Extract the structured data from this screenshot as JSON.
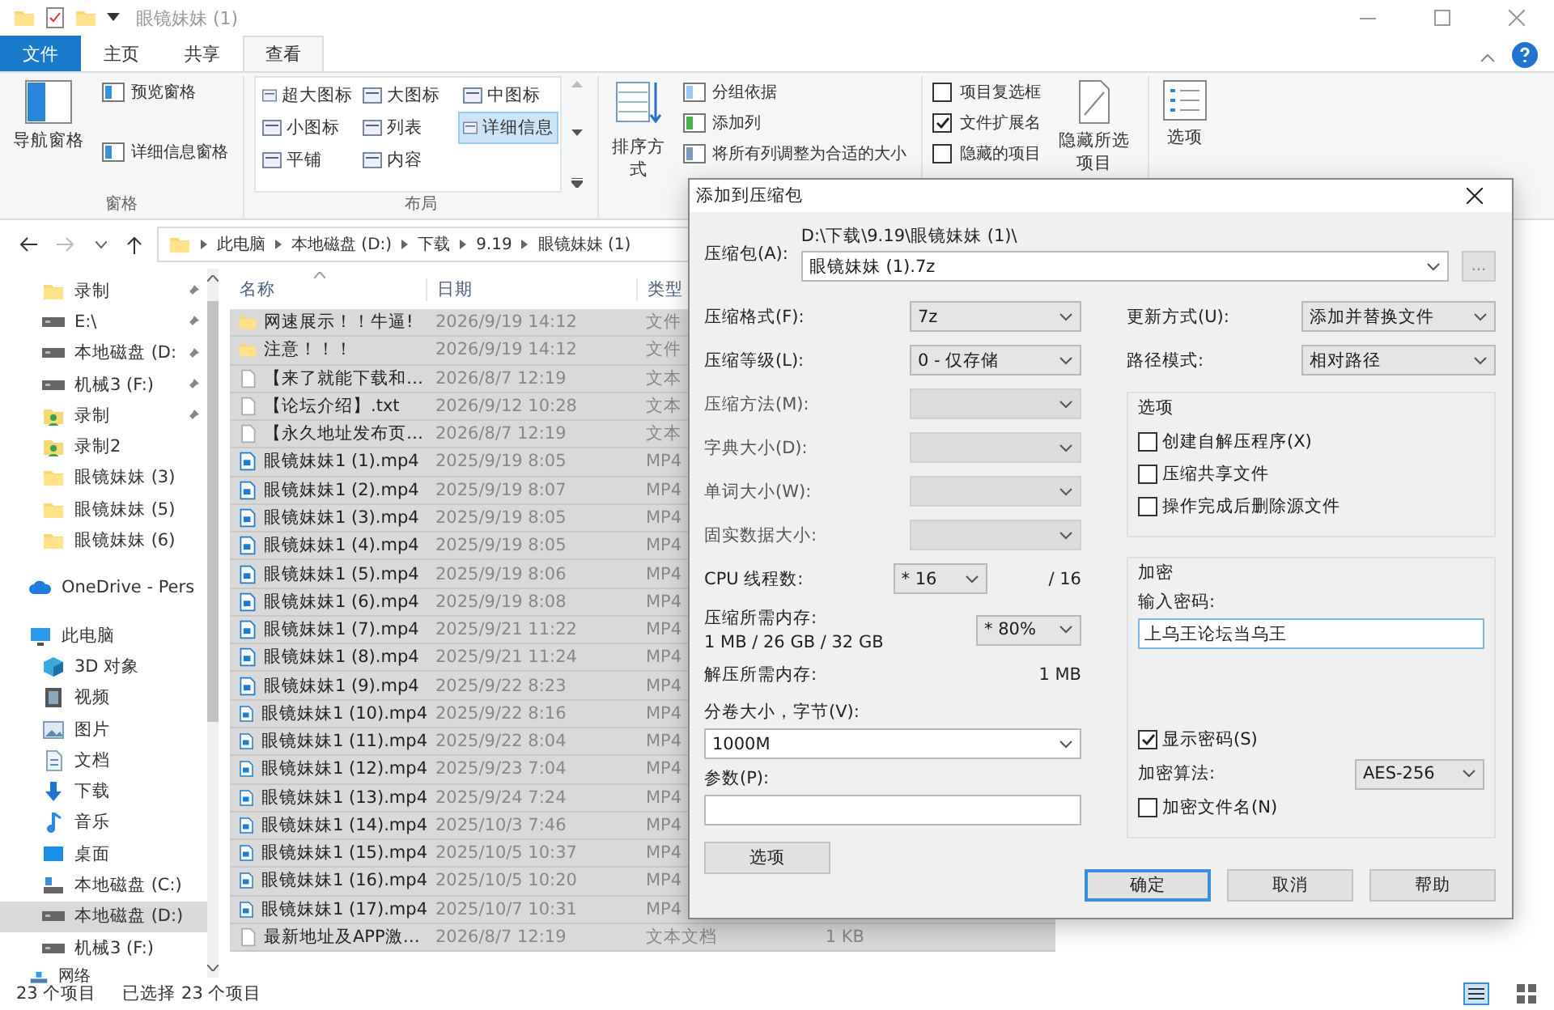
{
  "window": {
    "title": "眼镜妹妹 (1)"
  },
  "ribbon": {
    "tabs": [
      {
        "label": "文件",
        "kind": "file",
        "selected": false
      },
      {
        "label": "主页",
        "kind": "plain",
        "selected": false
      },
      {
        "label": "共享",
        "kind": "plain",
        "selected": false
      },
      {
        "label": "查看",
        "kind": "plain",
        "selected": true
      }
    ],
    "panes": {
      "nav": "导航窗格",
      "preview": "预览窗格",
      "details": "详细信息窗格",
      "group": "窗格"
    },
    "layout": {
      "group": "布局",
      "options": [
        {
          "label": "超大图标",
          "selected": false
        },
        {
          "label": "大图标",
          "selected": false
        },
        {
          "label": "中图标",
          "selected": false
        },
        {
          "label": "小图标",
          "selected": false
        },
        {
          "label": "列表",
          "selected": false
        },
        {
          "label": "详细信息",
          "selected": true
        },
        {
          "label": "平铺",
          "selected": false
        },
        {
          "label": "内容",
          "selected": false
        }
      ]
    },
    "current_view": {
      "sort": "排序方式",
      "group_by": "分组依据",
      "add_column": "添加列",
      "fit_columns": "将所有列调整为合适的大小"
    },
    "show_hide": {
      "checkboxes": [
        {
          "label": "项目复选框",
          "checked": false
        },
        {
          "label": "文件扩展名",
          "checked": true
        },
        {
          "label": "隐藏的项目",
          "checked": false
        }
      ],
      "hide_selected": "隐藏所选项目"
    },
    "options": "选项"
  },
  "address": {
    "crumbs": [
      "此电脑",
      "本地磁盘 (D:)",
      "下载",
      "9.19",
      "眼镜妹妹 (1)"
    ]
  },
  "nav": {
    "quick_access": [
      {
        "label": "录制",
        "kind": "folder",
        "pinned": true,
        "selected": false
      },
      {
        "label": "E:\\",
        "kind": "drive",
        "pinned": true,
        "selected": false
      },
      {
        "label": "本地磁盘 (D:",
        "kind": "drive",
        "pinned": true,
        "selected": false
      },
      {
        "label": "机械3 (F:)",
        "kind": "drive",
        "pinned": true,
        "selected": false
      },
      {
        "label": "录制",
        "kind": "user",
        "pinned": true,
        "selected": false
      },
      {
        "label": "录制2",
        "kind": "user",
        "pinned": false,
        "selected": false
      },
      {
        "label": "眼镜妹妹 (3)",
        "kind": "folder",
        "pinned": false,
        "selected": false
      },
      {
        "label": "眼镜妹妹 (5)",
        "kind": "folder",
        "pinned": false,
        "selected": false
      },
      {
        "label": "眼镜妹妹 (6)",
        "kind": "folder",
        "pinned": false,
        "selected": false
      }
    ],
    "onedrive": {
      "label": "OneDrive - Pers"
    },
    "this_pc": {
      "label": "此电脑",
      "children": [
        {
          "label": "3D 对象",
          "kind": "cube",
          "selected": false
        },
        {
          "label": "视频",
          "kind": "video",
          "selected": false
        },
        {
          "label": "图片",
          "kind": "image",
          "selected": false
        },
        {
          "label": "文档",
          "kind": "doc",
          "selected": false
        },
        {
          "label": "下载",
          "kind": "download",
          "selected": false
        },
        {
          "label": "音乐",
          "kind": "music",
          "selected": false
        },
        {
          "label": "桌面",
          "kind": "desktop",
          "selected": false
        },
        {
          "label": "本地磁盘 (C:)",
          "kind": "system",
          "selected": false
        },
        {
          "label": "本地磁盘 (D:)",
          "kind": "drive",
          "selected": true
        },
        {
          "label": "机械3 (F:)",
          "kind": "drive",
          "selected": false
        }
      ]
    },
    "network": {
      "label": "网络"
    }
  },
  "columns": [
    "名称",
    "日期",
    "类型"
  ],
  "files": [
    {
      "name": "网速展示！！牛逼!",
      "date": "2026/9/19 14:12",
      "type": "文件",
      "kind": "folder",
      "selected": true
    },
    {
      "name": "注意！！！",
      "date": "2026/9/19 14:12",
      "type": "文件",
      "kind": "folder",
      "selected": true
    },
    {
      "name": "【来了就能下载和…",
      "date": "2026/8/7 12:19",
      "type": "文本",
      "kind": "text",
      "selected": true
    },
    {
      "name": "【论坛介绍】.txt",
      "date": "2026/9/12 10:28",
      "type": "文本",
      "kind": "text",
      "selected": true
    },
    {
      "name": "【永久地址发布页…",
      "date": "2026/8/7 12:19",
      "type": "文本",
      "kind": "text",
      "selected": true
    },
    {
      "name": "眼镜妹妹1 (1).mp4",
      "date": "2025/9/19 8:05",
      "type": "MP4",
      "kind": "video",
      "selected": true
    },
    {
      "name": "眼镜妹妹1 (2).mp4",
      "date": "2025/9/19 8:07",
      "type": "MP4",
      "kind": "video",
      "selected": true
    },
    {
      "name": "眼镜妹妹1 (3).mp4",
      "date": "2025/9/19 8:05",
      "type": "MP4",
      "kind": "video",
      "selected": true
    },
    {
      "name": "眼镜妹妹1 (4).mp4",
      "date": "2025/9/19 8:05",
      "type": "MP4",
      "kind": "video",
      "selected": true
    },
    {
      "name": "眼镜妹妹1 (5).mp4",
      "date": "2025/9/19 8:06",
      "type": "MP4",
      "kind": "video",
      "selected": true
    },
    {
      "name": "眼镜妹妹1 (6).mp4",
      "date": "2025/9/19 8:08",
      "type": "MP4",
      "kind": "video",
      "selected": true
    },
    {
      "name": "眼镜妹妹1 (7).mp4",
      "date": "2025/9/21 11:22",
      "type": "MP4",
      "kind": "video",
      "selected": true
    },
    {
      "name": "眼镜妹妹1 (8).mp4",
      "date": "2025/9/21 11:24",
      "type": "MP4",
      "kind": "video",
      "selected": true
    },
    {
      "name": "眼镜妹妹1 (9).mp4",
      "date": "2025/9/22 8:23",
      "type": "MP4",
      "kind": "video",
      "selected": true
    },
    {
      "name": "眼镜妹妹1 (10).mp4",
      "date": "2025/9/22 8:16",
      "type": "MP4",
      "kind": "video",
      "selected": true
    },
    {
      "name": "眼镜妹妹1 (11).mp4",
      "date": "2025/9/22 8:04",
      "type": "MP4",
      "kind": "video",
      "selected": true
    },
    {
      "name": "眼镜妹妹1 (12).mp4",
      "date": "2025/9/23 7:04",
      "type": "MP4",
      "kind": "video",
      "selected": true
    },
    {
      "name": "眼镜妹妹1 (13).mp4",
      "date": "2025/9/24 7:24",
      "type": "MP4",
      "kind": "video",
      "selected": true
    },
    {
      "name": "眼镜妹妹1 (14).mp4",
      "date": "2025/10/3 7:46",
      "type": "MP4",
      "kind": "video",
      "selected": true
    },
    {
      "name": "眼镜妹妹1 (15).mp4",
      "date": "2025/10/5 10:37",
      "type": "MP4",
      "kind": "video",
      "selected": true
    },
    {
      "name": "眼镜妹妹1 (16).mp4",
      "date": "2025/10/5 10:20",
      "type": "MP4",
      "kind": "video",
      "selected": true
    },
    {
      "name": "眼镜妹妹1 (17).mp4",
      "date": "2025/10/7 10:31",
      "type": "MP4",
      "kind": "video",
      "selected": true
    },
    {
      "name": "最新地址及APP激…",
      "date": "2026/8/7 12:19",
      "type": "文本文档",
      "size": "1 KB",
      "kind": "text",
      "selected": true
    }
  ],
  "status_bar": {
    "count": "23 个项目",
    "selection": "已选择 23 个项目"
  },
  "dialog": {
    "title": "添加到压缩包",
    "archive": {
      "label": "压缩包(A):",
      "path": "D:\\下载\\9.19\\眼镜妹妹 (1)\\",
      "value": "眼镜妹妹 (1).7z",
      "browse": "..."
    },
    "left_fields": [
      {
        "label": "压缩格式(F):",
        "value": "7z",
        "disabled": false
      },
      {
        "label": "压缩等级(L):",
        "value": "0 - 仅存储",
        "disabled": false
      },
      {
        "label": "压缩方法(M):",
        "disabled": true
      },
      {
        "label": "字典大小(D):",
        "disabled": true
      },
      {
        "label": "单词大小(W):",
        "disabled": true
      },
      {
        "label": "固实数据大小:",
        "disabled": true
      }
    ],
    "cpu": {
      "label": "CPU 线程数:",
      "value": "* 16",
      "max": "/ 16"
    },
    "memory": {
      "label": "压缩所需内存:",
      "detail": "1 MB / 26 GB / 32 GB",
      "value": "* 80%"
    },
    "decompress_memory": {
      "label": "解压所需内存:",
      "value": "1 MB"
    },
    "volume": {
      "label": "分卷大小，字节(V):",
      "value": "1000M"
    },
    "params": {
      "label": "参数(P):"
    },
    "options_button": "选项",
    "update": {
      "label": "更新方式(U):",
      "value": "添加并替换文件"
    },
    "path_mode": {
      "label": "路径模式:",
      "value": "相对路径"
    },
    "options_group": {
      "title": "选项",
      "checkboxes": [
        {
          "label": "创建自解压程序(X)",
          "checked": false
        },
        {
          "label": "压缩共享文件",
          "checked": false
        },
        {
          "label": "操作完成后删除源文件",
          "checked": false
        }
      ]
    },
    "encryption": {
      "title": "加密",
      "password_label": "输入密码:",
      "password": "上乌王论坛当乌王",
      "show_password": {
        "label": "显示密码(S)",
        "checked": true
      },
      "method_label": "加密算法:",
      "method": "AES-256",
      "encrypt_names": {
        "label": "加密文件名(N)",
        "checked": false
      }
    },
    "buttons": [
      {
        "label": "确定",
        "default": true
      },
      {
        "label": "取消",
        "default": false
      },
      {
        "label": "帮助",
        "default": false
      }
    ]
  }
}
